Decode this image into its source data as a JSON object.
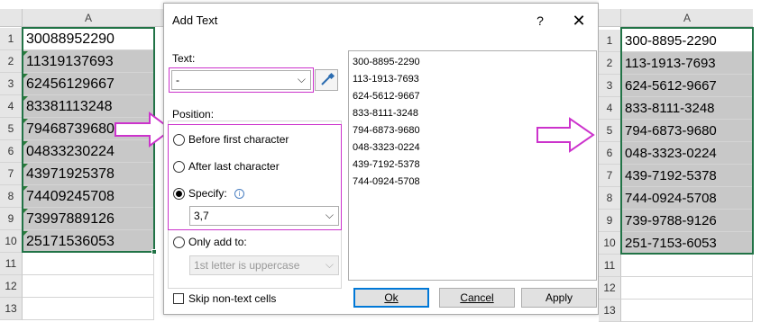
{
  "left_sheet": {
    "column": "A",
    "rows": [
      "1",
      "2",
      "3",
      "4",
      "5",
      "6",
      "7",
      "8",
      "9",
      "10",
      "11",
      "12",
      "13"
    ],
    "values": [
      "30088952290",
      "11319137693",
      "62456129667",
      "83381113248",
      "79468739680",
      "04833230224",
      "43971925378",
      "74409245708",
      "73997889126",
      "25171536053"
    ]
  },
  "dialog": {
    "title": "Add Text",
    "help": "?",
    "close": "✕",
    "text_label": "Text:",
    "text_value": "-",
    "position_label": "Position:",
    "options": {
      "before": "Before first character",
      "after": "After last character",
      "specify": "Specify:",
      "only_add": "Only add to:"
    },
    "specify_value": "3,7",
    "only_add_value": "1st letter is uppercase",
    "preview": [
      "300-8895-2290",
      "113-1913-7693",
      "624-5612-9667",
      "833-8111-3248",
      "794-6873-9680",
      "048-3323-0224",
      "439-7192-5378",
      "744-0924-5708"
    ],
    "skip_label": "Skip non-text cells",
    "buttons": {
      "ok": "Ok",
      "cancel": "Cancel",
      "apply": "Apply"
    }
  },
  "right_sheet": {
    "column": "A",
    "rows": [
      "1",
      "2",
      "3",
      "4",
      "5",
      "6",
      "7",
      "8",
      "9",
      "10",
      "11",
      "12",
      "13"
    ],
    "values": [
      "300-8895-2290",
      "113-1913-7693",
      "624-5612-9667",
      "833-8111-3248",
      "794-6873-9680",
      "048-3323-0224",
      "439-7192-5378",
      "744-0924-5708",
      "739-9788-9126",
      "251-7153-6053"
    ]
  },
  "colors": {
    "arrow": "#cc33cc",
    "selection": "#217346",
    "highlight": "#cc33cc"
  }
}
